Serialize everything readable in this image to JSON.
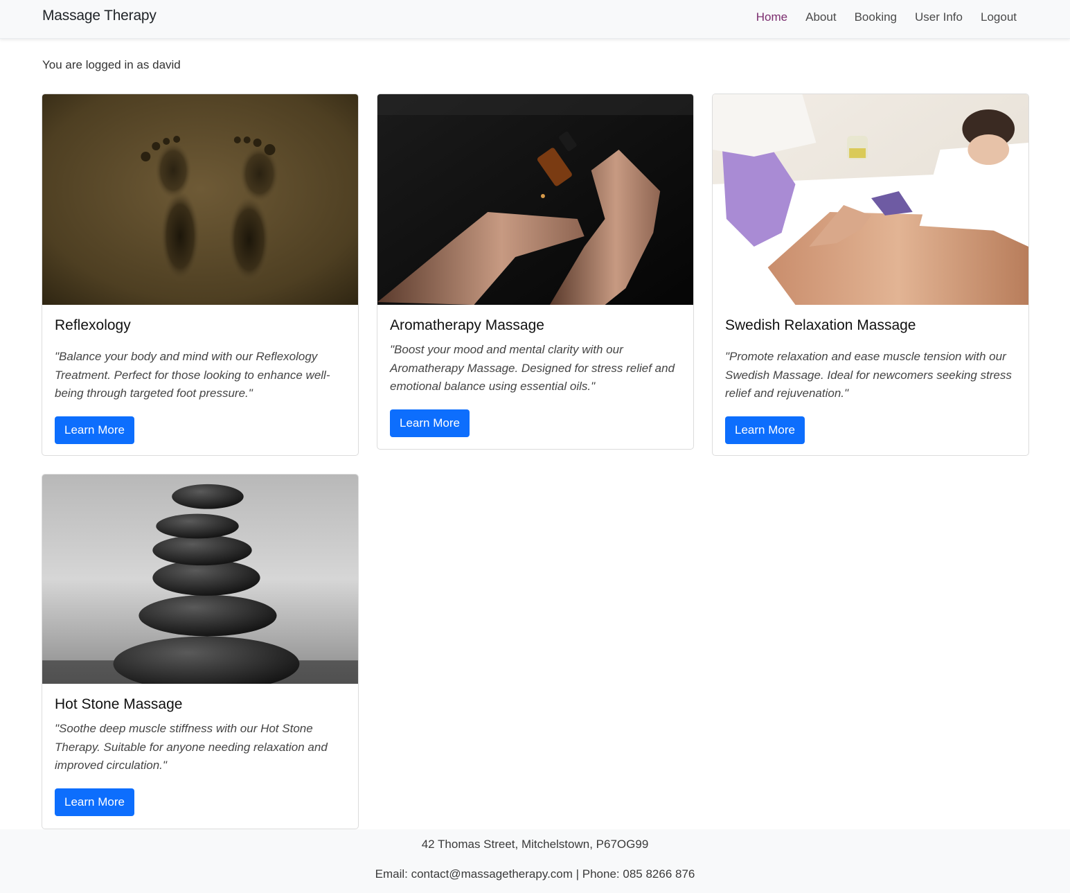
{
  "nav": {
    "brand": "Massage Therapy",
    "links": [
      "Home",
      "About",
      "Booking",
      "User Info",
      "Logout"
    ]
  },
  "login_message": "You are logged in as david",
  "cards": [
    {
      "title": "Reflexology",
      "text": "\"Balance your body and mind with our Reflexology Treatment. Perfect for those looking to enhance well-being through targeted foot pressure.\"",
      "button": "Learn More"
    },
    {
      "title": "Aromatherapy Massage",
      "text": "\"Boost your mood and mental clarity with our Aromatherapy Massage. Designed for stress relief and emotional balance using essential oils.\"",
      "button": "Learn More"
    },
    {
      "title": "Swedish Relaxation Massage",
      "text": "\"Promote relaxation and ease muscle tension with our Swedish Massage. Ideal for newcomers seeking stress relief and rejuvenation.\"",
      "button": "Learn More"
    },
    {
      "title": "Hot Stone Massage",
      "text": "\"Soothe deep muscle stiffness with our Hot Stone Therapy. Suitable for anyone needing relaxation and improved circulation.\"",
      "button": "Learn More"
    }
  ],
  "footer": {
    "address": "42 Thomas Street, Mitchelstown, P67OG99",
    "contact": "Email: contact@massagetherapy.com | Phone: 085 8266 876"
  },
  "colors": {
    "primary_button": "#0d6efd",
    "active_nav": "#7b2d6e",
    "navbar_bg": "#f8f9fa",
    "footer_bg": "#f8f9fa"
  }
}
